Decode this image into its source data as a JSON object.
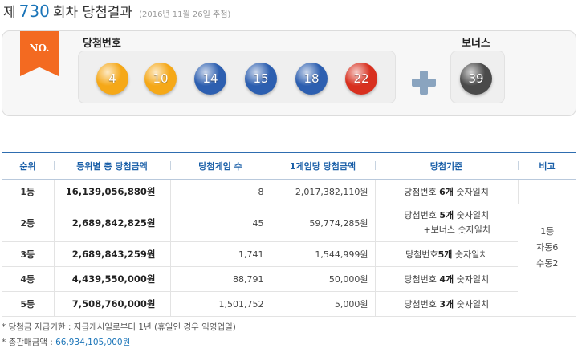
{
  "title": {
    "prefix": "제",
    "round": "730",
    "suffix": "회차 당첨결과",
    "date": "(2016년 11월 26일 추첨)"
  },
  "panel": {
    "ribbon_text": "NO.",
    "numbers_label": "당첨번호",
    "bonus_label": "보너스",
    "numbers": [
      {
        "value": "4",
        "color": "#f5a818"
      },
      {
        "value": "10",
        "color": "#f5a818"
      },
      {
        "value": "14",
        "color": "#2d5fb0"
      },
      {
        "value": "15",
        "color": "#2d5fb0"
      },
      {
        "value": "18",
        "color": "#2d5fb0"
      },
      {
        "value": "22",
        "color": "#d8301f"
      }
    ],
    "bonus": {
      "value": "39",
      "color": "#4a4a4a"
    },
    "plus_icon": "plus-icon"
  },
  "table": {
    "headers": [
      "순위",
      "등위별 총 당첨금액",
      "당첨게임 수",
      "1게임당 당첨금액",
      "당첨기준",
      "비고"
    ],
    "rows": [
      {
        "rank": "1등",
        "total": "16,139,056,880원",
        "count": "8",
        "per": "2,017,382,110원",
        "crit1": "당첨번호 ",
        "crit_b": "6개",
        "crit2": " 숫자일치",
        "crit_extra": ""
      },
      {
        "rank": "2등",
        "total": "2,689,842,825원",
        "count": "45",
        "per": "59,774,285원",
        "crit1": "당첨번호 ",
        "crit_b": "5개",
        "crit2": " 숫자일치",
        "crit_extra": "+보너스 숫자일치"
      },
      {
        "rank": "3등",
        "total": "2,689,843,259원",
        "count": "1,741",
        "per": "1,544,999원",
        "crit1": "당첨번호",
        "crit_b": "5개",
        "crit2": " 숫자일치",
        "crit_extra": ""
      },
      {
        "rank": "4등",
        "total": "4,439,550,000원",
        "count": "88,791",
        "per": "50,000원",
        "crit1": "당첨번호 ",
        "crit_b": "4개",
        "crit2": " 숫자일치",
        "crit_extra": ""
      },
      {
        "rank": "5등",
        "total": "7,508,760,000원",
        "count": "1,501,752",
        "per": "5,000원",
        "crit1": "당첨번호 ",
        "crit_b": "3개",
        "crit2": " 숫자일치",
        "crit_extra": ""
      }
    ],
    "note": {
      "line1": "1등",
      "line2": "자동6",
      "line3": "수동2"
    }
  },
  "footer": {
    "deadline": "* 당첨금 지급기한 : 지급개시일로부터 1년 (휴일인 경우 익영업일)",
    "sales_label": "* 총판매금액 : ",
    "sales_amount": "66,934,105,000원"
  }
}
